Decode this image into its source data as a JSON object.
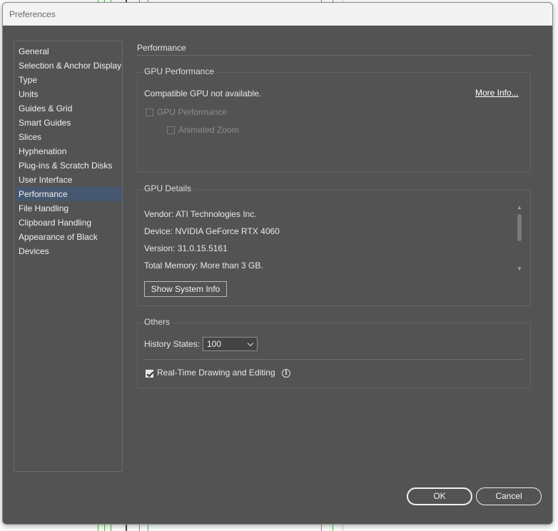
{
  "window": {
    "title": "Preferences"
  },
  "sidebar": {
    "items": [
      {
        "label": "General"
      },
      {
        "label": "Selection & Anchor Display"
      },
      {
        "label": "Type"
      },
      {
        "label": "Units"
      },
      {
        "label": "Guides & Grid"
      },
      {
        "label": "Smart Guides"
      },
      {
        "label": "Slices"
      },
      {
        "label": "Hyphenation"
      },
      {
        "label": "Plug-ins & Scratch Disks"
      },
      {
        "label": "User Interface"
      },
      {
        "label": "Performance"
      },
      {
        "label": "File Handling"
      },
      {
        "label": "Clipboard Handling"
      },
      {
        "label": "Appearance of Black"
      },
      {
        "label": "Devices"
      }
    ],
    "selected_index": 10
  },
  "main": {
    "title": "Performance",
    "gpu_performance": {
      "label": "GPU Performance",
      "status": "Compatible GPU not available.",
      "more_info": "More Info...",
      "gpu_checkbox_label": "GPU Performance",
      "gpu_checkbox_checked": false,
      "animated_zoom_label": "Animated Zoom",
      "animated_zoom_checked": false
    },
    "gpu_details": {
      "label": "GPU Details",
      "lines": [
        "Vendor: ATI Technologies Inc.",
        "Device: NVIDIA GeForce RTX 4060",
        "Version: 31.0.15.5161",
        "Total Memory:  More than 3 GB."
      ],
      "show_system_info": "Show System Info"
    },
    "others": {
      "label": "Others",
      "history_label": "History States:",
      "history_value": "100",
      "realtime_label": "Real-Time Drawing and Editing",
      "realtime_checked": true
    }
  },
  "footer": {
    "ok": "OK",
    "cancel": "Cancel"
  }
}
